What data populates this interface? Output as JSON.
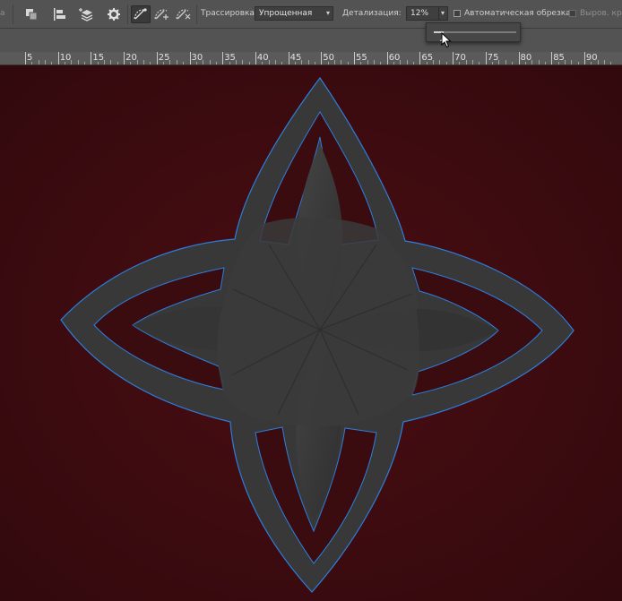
{
  "toolbar": {
    "partial_label": "а",
    "trace_label": "Трассировка:",
    "trace_value": "Упрощенная",
    "detail_label": "Детализация:",
    "detail_value": "12%",
    "autocrop_label": "Автоматическая обрезка",
    "align_label": "Выров. кра"
  },
  "icons": [
    "arrange-icon",
    "align-icon",
    "layers-stack-icon",
    "gear-icon",
    "path-op-1-icon",
    "path-op-2-icon",
    "path-op-3-icon"
  ],
  "detail_slider": {
    "value_fraction": 0.12
  },
  "ruler": {
    "ticks": [
      "5",
      "10",
      "15",
      "20",
      "25",
      "30",
      "35",
      "40",
      "45",
      "50",
      "55",
      "60",
      "65",
      "70",
      "75",
      "80",
      "85",
      "90"
    ]
  },
  "colors": {
    "toolbar": "#535353",
    "canvas": "#3a0c10",
    "path_stroke": "#2a7fe0",
    "shape": "#383838"
  }
}
